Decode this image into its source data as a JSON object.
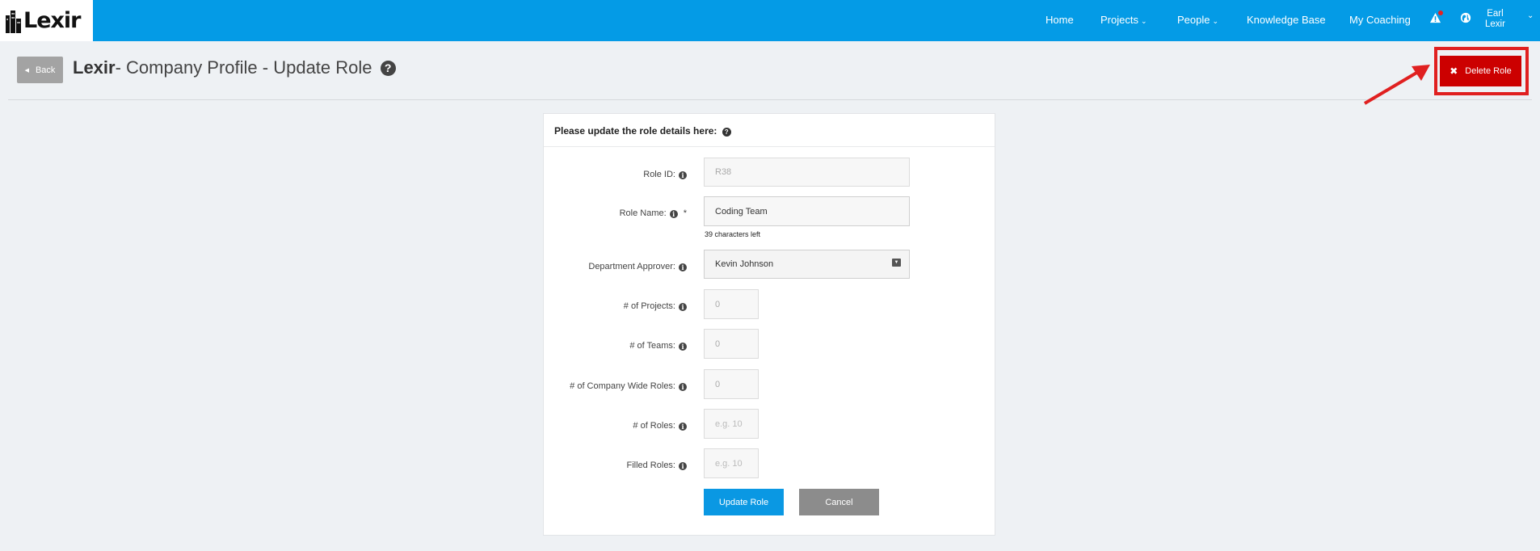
{
  "app": {
    "logo_text": "Lexir"
  },
  "nav": {
    "items": [
      {
        "label": "Home",
        "dropdown": false
      },
      {
        "label": "Projects",
        "dropdown": true
      },
      {
        "label": "People",
        "dropdown": true
      },
      {
        "label": "Knowledge Base",
        "dropdown": false
      },
      {
        "label": "My Coaching",
        "dropdown": false
      }
    ],
    "alert_icon": "warning-icon",
    "globe_icon": "globe-icon",
    "user": {
      "first": "Earl",
      "last": "Lexir"
    },
    "caret": "⌄"
  },
  "header": {
    "back_label": "Back",
    "company": "Lexir",
    "title_rest": "- Company Profile - Update Role",
    "help_glyph": "?",
    "delete_label": "Delete Role",
    "delete_glyph": "✖"
  },
  "form": {
    "heading": "Please update the role details here:",
    "info_glyph": "i",
    "fields": {
      "role_id": {
        "label": "Role ID:",
        "value": "R38"
      },
      "role_name": {
        "label": "Role Name:",
        "required": "*",
        "value": "Coding Team",
        "chars_left": "39 characters left"
      },
      "department_approver": {
        "label": "Department Approver:",
        "value": "Kevin Johnson"
      },
      "num_projects": {
        "label": "# of Projects:",
        "value": "0"
      },
      "num_teams": {
        "label": "# of Teams:",
        "value": "0"
      },
      "num_company_wide_roles": {
        "label": "# of Company Wide Roles:",
        "value": "0"
      },
      "num_roles": {
        "label": "# of Roles:",
        "placeholder": "e.g. 10"
      },
      "filled_roles": {
        "label": "Filled Roles:",
        "placeholder": "e.g. 10"
      }
    },
    "update_label": "Update Role",
    "cancel_label": "Cancel"
  },
  "colors": {
    "nav_bg": "#049be6",
    "delete_bg": "#cc0000",
    "highlight": "#e02020",
    "update_bg": "#0a98e3",
    "cancel_bg": "#8c8c8c"
  }
}
